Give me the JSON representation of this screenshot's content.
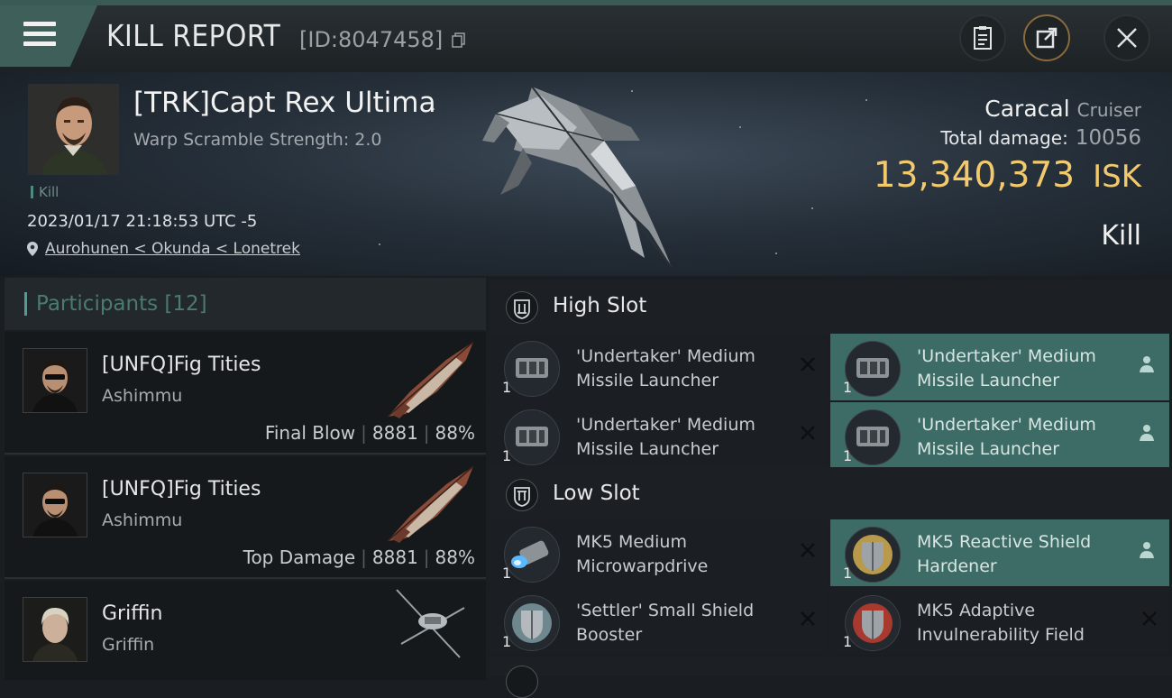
{
  "header": {
    "title": "KILL REPORT",
    "id_text": "[ID:8047458]"
  },
  "victim": {
    "name": "[TRK]Capt Rex Ultima",
    "warp_scramble": "Warp Scramble Strength: 2.0",
    "kill_tag": "Kill",
    "datetime": "2023/01/17 21:18:53 UTC -5",
    "location": "Aurohunen < Okunda < Lonetrek"
  },
  "ship": {
    "name": "Caracal",
    "class": "Cruiser",
    "total_damage_label": "Total damage:",
    "total_damage_value": "10056",
    "isk_value": "13,340,373",
    "isk_unit": "ISK",
    "result": "Kill"
  },
  "participants": {
    "title": "Participants",
    "count": "[12]",
    "rows": [
      {
        "name": "[UNFQ]Fig Tities",
        "corp": "Ashimmu",
        "role": "Final Blow",
        "damage": "8881",
        "percent": "88%"
      },
      {
        "name": "[UNFQ]Fig Tities",
        "corp": "Ashimmu",
        "role": "Top Damage",
        "damage": "8881",
        "percent": "88%"
      },
      {
        "name": "Griffin",
        "corp": "Griffin",
        "role": "",
        "damage": "",
        "percent": ""
      }
    ]
  },
  "slots": {
    "high": {
      "label": "High Slot",
      "modules": [
        {
          "name": "'Undertaker' Medium Missile Launcher",
          "qty": "1",
          "status": "destroyed"
        },
        {
          "name": "'Undertaker' Medium Missile Launcher",
          "qty": "1",
          "status": "dropped"
        },
        {
          "name": "'Undertaker' Medium Missile Launcher",
          "qty": "1",
          "status": "destroyed"
        },
        {
          "name": "'Undertaker' Medium Missile Launcher",
          "qty": "1",
          "status": "dropped"
        }
      ]
    },
    "low": {
      "label": "Low Slot",
      "modules": [
        {
          "name": "MK5 Medium Microwarpdrive",
          "qty": "1",
          "status": "destroyed"
        },
        {
          "name": "MK5 Reactive Shield Hardener",
          "qty": "1",
          "status": "dropped"
        },
        {
          "name": "'Settler' Small Shield Booster",
          "qty": "1",
          "status": "destroyed"
        },
        {
          "name": "MK5 Adaptive Invulnerability Field",
          "qty": "1",
          "status": "destroyed"
        }
      ]
    }
  },
  "colors": {
    "accent_teal": "#3d6b65",
    "isk_gold": "#f3c96e",
    "dropped_bg": "#3d6b65",
    "destroyed_bg": "#1b1f23"
  }
}
